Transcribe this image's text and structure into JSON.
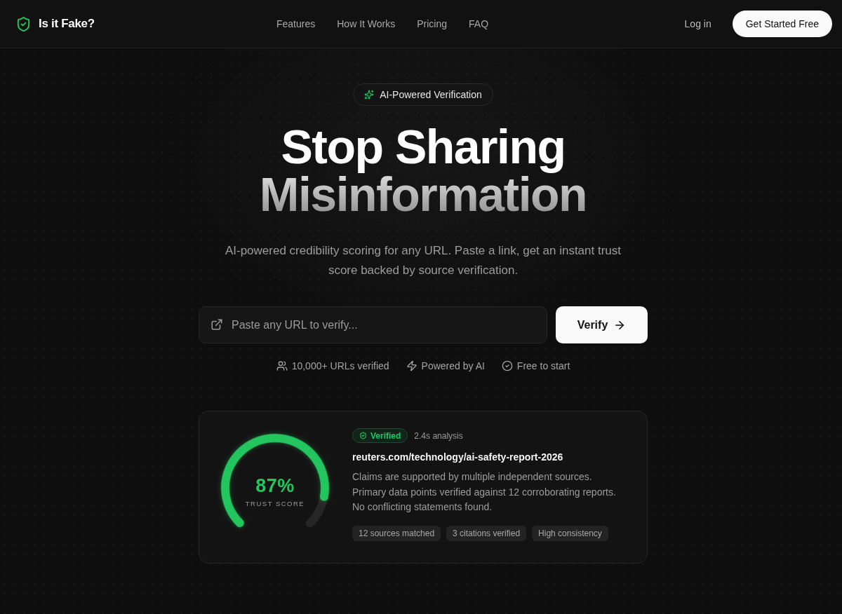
{
  "nav": {
    "logo": "Is it Fake?",
    "links": [
      {
        "label": "Features"
      },
      {
        "label": "How It Works"
      },
      {
        "label": "Pricing"
      },
      {
        "label": "FAQ"
      }
    ],
    "login": "Log in",
    "cta": "Get Started Free"
  },
  "hero": {
    "badge": "AI-Powered Verification",
    "title_line_1": "Stop Sharing",
    "title_line_2": "Misinformation",
    "subtitle": "AI-powered credibility scoring for any URL. Paste a link, get an instant trust score backed by source verification.",
    "url_field": {
      "placeholder": "Paste any URL to verify..."
    },
    "verify_button": "Verify",
    "highlights": [
      {
        "kind": "users",
        "label": "10,000+ URLs verified"
      },
      {
        "kind": "bolt",
        "label": "Powered by AI"
      },
      {
        "kind": "check",
        "label": "Free to start"
      }
    ]
  },
  "result_card": {
    "gauge": {
      "level": 0.87,
      "score": "87%",
      "label": "TRUST SCORE"
    },
    "status": {
      "kind": "verified",
      "label": "Verified"
    },
    "analysis_time": "2.4s analysis",
    "url": "reuters.com/technology/ai-safety-report-2026",
    "summary": "Claims are supported by multiple independent sources. Primary data points verified against 12 corroborating reports. No conflicting statements found.",
    "tags": [
      "12 sources matched",
      "3 citations verified",
      "High consistency"
    ]
  }
}
